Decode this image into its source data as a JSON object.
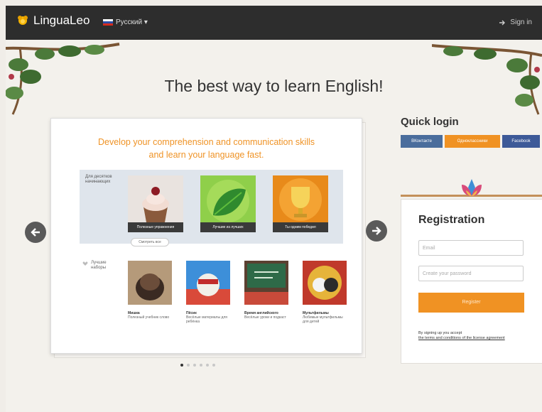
{
  "header": {
    "logo_text": "LinguaLeo",
    "language": "Русский ▾",
    "signin": "Sign in"
  },
  "headline": "The best way to learn English!",
  "slide": {
    "title_line1": "Develop your comprehension and communication skills",
    "title_line2": "and learn your language fast.",
    "features_label": "Для десятков начинающих",
    "features": [
      {
        "caption": "Полезные упражнения"
      },
      {
        "caption": "Лучшие из лучших"
      },
      {
        "caption": "Ты одним победил"
      }
    ],
    "features_button": "Смотреть все",
    "sets_label": "Лучшие наборы",
    "sets": [
      {
        "name": "Мишка",
        "desc": "Полезный учебник слово"
      },
      {
        "name": "Пёсик",
        "desc": "Весёлые материалы для ребёнка"
      },
      {
        "name": "Время английского",
        "desc": "Весёлые уроки и подкаст"
      },
      {
        "name": "Мультфильмы",
        "desc": "Любимые мультфильмы для детей"
      }
    ],
    "active_dot": 0,
    "dot_count": 6
  },
  "quick_login": {
    "title": "Quick login",
    "buttons": [
      {
        "label": "ВКонтакте",
        "color": "#4a6d9c"
      },
      {
        "label": "Одноклассники",
        "color": "#f09223"
      },
      {
        "label": "Facebook",
        "color": "#3d5a98"
      }
    ]
  },
  "registration": {
    "title": "Registration",
    "email_placeholder": "Email",
    "password_placeholder": "Create your password",
    "submit": "Register",
    "terms_line1": "By signing up you accept",
    "terms_link": "the terms and conditions of the license agreement"
  },
  "colors": {
    "accent": "#f09223",
    "topbar": "#2d2d2d",
    "social_vk": "#4a6d9c",
    "social_fb": "#3d5a98"
  }
}
